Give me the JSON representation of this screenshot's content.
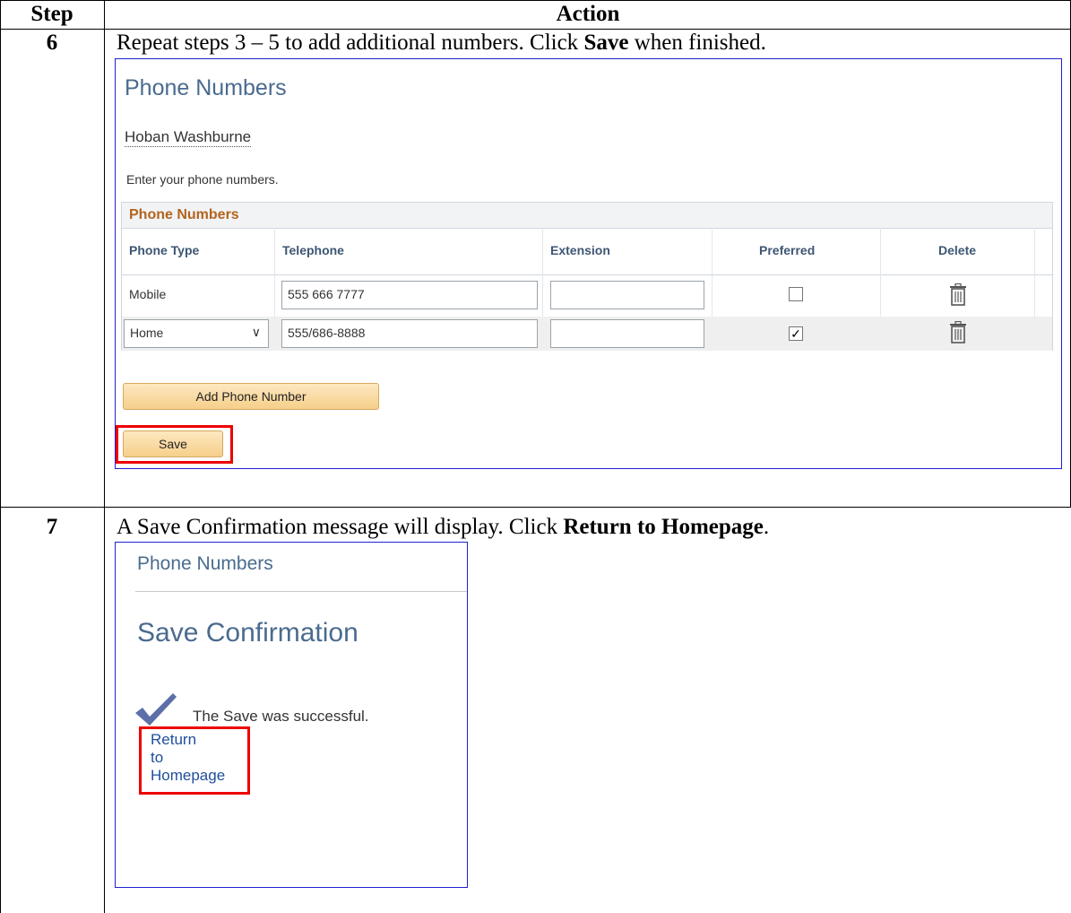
{
  "header": {
    "step": "Step",
    "action": "Action"
  },
  "steps": [
    {
      "num": "6",
      "text_before": "Repeat steps 3 – 5 to add additional numbers.  Click ",
      "text_bold": "Save",
      "text_after": " when finished."
    },
    {
      "num": "7",
      "text_before": "A Save Confirmation message will display.  Click ",
      "text_bold": "Return to Homepage",
      "text_after": "."
    }
  ],
  "screen1": {
    "title": "Phone Numbers",
    "person": "Hoban Washburne",
    "instruction": "Enter your phone numbers.",
    "grid_title": "Phone Numbers",
    "columns": [
      "Phone Type",
      "Telephone",
      "Extension",
      "Preferred",
      "Delete"
    ],
    "rows": [
      {
        "type": "Mobile",
        "telephone": "555 666 7777",
        "extension": "",
        "preferred": false
      },
      {
        "type": "Home",
        "telephone": "555/686-8888",
        "extension": "",
        "preferred": true
      }
    ],
    "add_button": "Add Phone Number",
    "save_button": "Save"
  },
  "screen2": {
    "title": "Phone Numbers",
    "confirmation": "Save Confirmation",
    "message": "The Save was successful.",
    "link_lines": [
      "Return",
      "to",
      "Homepage"
    ]
  },
  "colors": {
    "highlight": "#ee0000",
    "frame": "#2020d0",
    "title": "#4a6b8f",
    "grid_title": "#b3641d"
  }
}
